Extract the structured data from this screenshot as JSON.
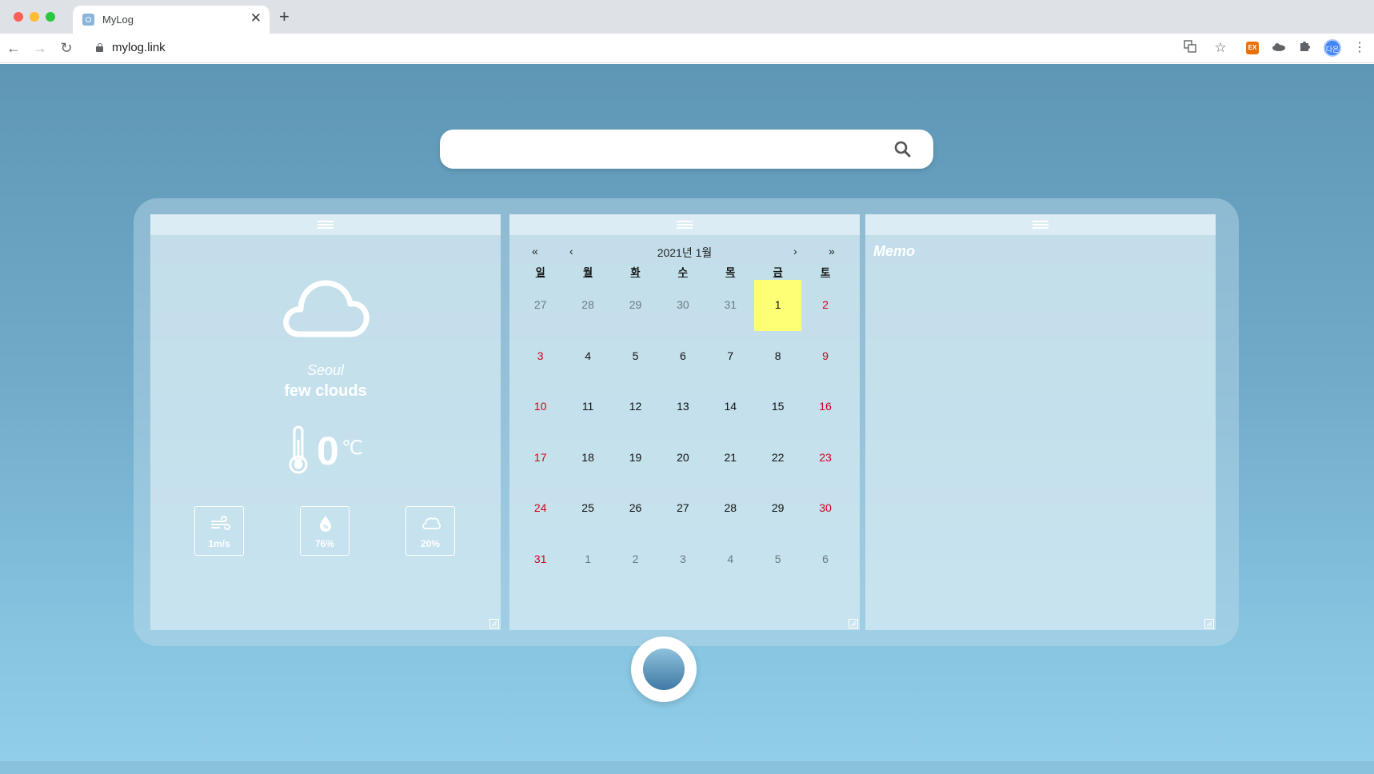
{
  "browser": {
    "tab_title": "MyLog",
    "tab_close": "✕",
    "new_tab": "+",
    "url": "mylog.link",
    "extension_badge": "EX",
    "profile_initials": "다은"
  },
  "search": {
    "placeholder": ""
  },
  "weather": {
    "condition_icon": "cloud-icon",
    "city": "Seoul",
    "description": "few clouds",
    "temperature": "0",
    "unit": "℃",
    "wind": "1m/s",
    "humidity": "76%",
    "cloudiness": "20%"
  },
  "calendar": {
    "title": "2021년 1월",
    "nav_prev_year": "«",
    "nav_prev_month": "‹",
    "nav_next_month": "›",
    "nav_next_year": "»",
    "weekdays": [
      "일",
      "월",
      "화",
      "수",
      "목",
      "금",
      "토"
    ],
    "weeks": [
      [
        "27",
        "28",
        "29",
        "30",
        "31",
        "1",
        "2"
      ],
      [
        "3",
        "4",
        "5",
        "6",
        "7",
        "8",
        "9"
      ],
      [
        "10",
        "11",
        "12",
        "13",
        "14",
        "15",
        "16"
      ],
      [
        "17",
        "18",
        "19",
        "20",
        "21",
        "22",
        "23"
      ],
      [
        "24",
        "25",
        "26",
        "27",
        "28",
        "29",
        "30"
      ],
      [
        "31",
        "1",
        "2",
        "3",
        "4",
        "5",
        "6"
      ]
    ],
    "today_highlight_color": "#ffff76",
    "weekend_color": "#d0021b"
  },
  "memo": {
    "title": "Memo"
  },
  "colors": {
    "background_top": "#5e97b5",
    "background_bottom": "#93cfe9"
  }
}
